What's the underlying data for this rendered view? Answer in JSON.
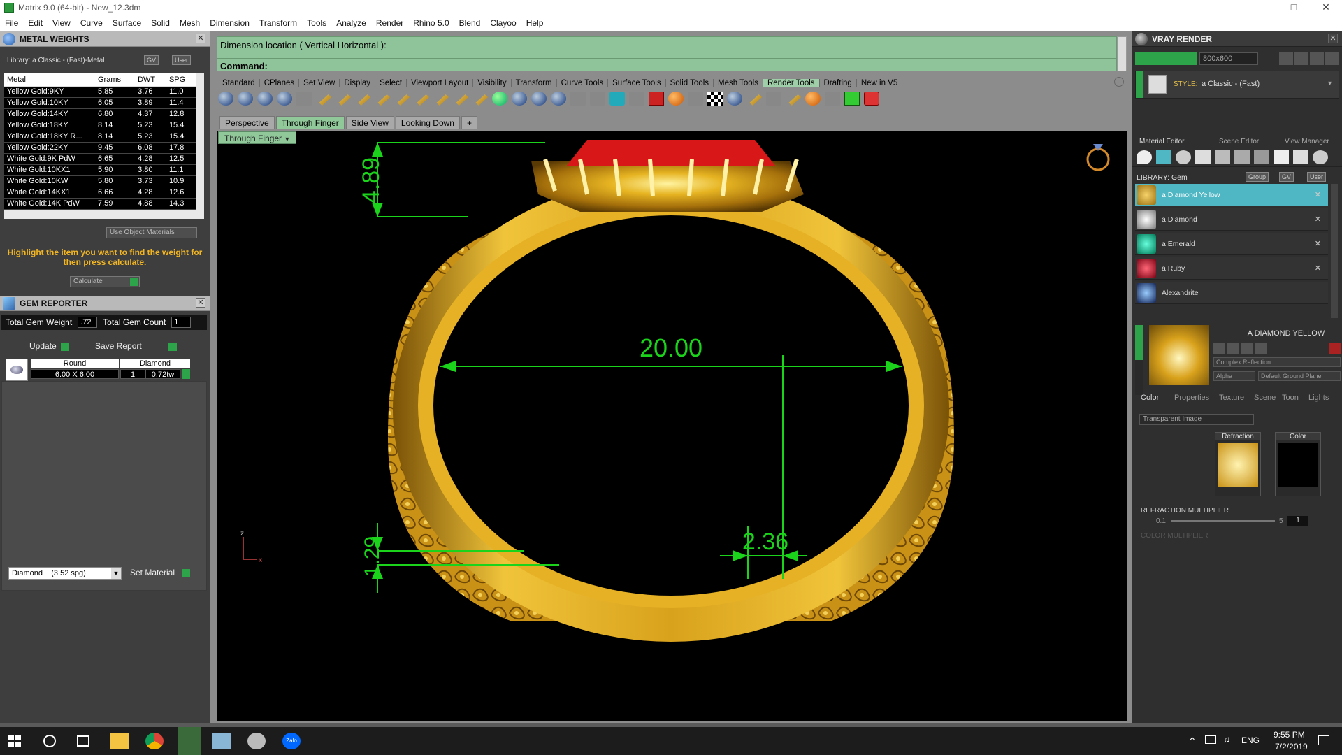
{
  "window": {
    "title": "Matrix 9.0 (64-bit) - New_12.3dm"
  },
  "menu": [
    "File",
    "Edit",
    "View",
    "Curve",
    "Surface",
    "Solid",
    "Mesh",
    "Dimension",
    "Transform",
    "Tools",
    "Analyze",
    "Render",
    "Rhino 5.0",
    "Blend",
    "Clayoo",
    "Help"
  ],
  "metal_weights": {
    "title": "METAL WEIGHTS",
    "library": "Library: a Classic - (Fast)-Metal",
    "gv_label": "GV",
    "user_label": "User",
    "columns": [
      "Metal",
      "Grams",
      "DWT",
      "SPG"
    ],
    "rows": [
      [
        "Yellow Gold:9KY",
        "5.85",
        "3.76",
        "11.0"
      ],
      [
        "Yellow Gold:10KY",
        "6.05",
        "3.89",
        "11.4"
      ],
      [
        "Yellow Gold:14KY",
        "6.80",
        "4.37",
        "12.8"
      ],
      [
        "Yellow Gold:18KY",
        "8.14",
        "5.23",
        "15.4"
      ],
      [
        "Yellow Gold:18KY R...",
        "8.14",
        "5.23",
        "15.4"
      ],
      [
        "Yellow Gold:22KY",
        "9.45",
        "6.08",
        "17.8"
      ],
      [
        "White Gold:9K PdW",
        "6.65",
        "4.28",
        "12.5"
      ],
      [
        "White Gold:10KX1",
        "5.90",
        "3.80",
        "11.1"
      ],
      [
        "White Gold:10KW",
        "5.80",
        "3.73",
        "10.9"
      ],
      [
        "White Gold:14KX1",
        "6.66",
        "4.28",
        "12.6"
      ],
      [
        "White Gold:14K PdW",
        "7.59",
        "4.88",
        "14.3"
      ]
    ],
    "use_object_materials": "Use Object Materials",
    "hint": "Highlight the item you want to find the weight for then press calculate.",
    "calculate": "Calculate"
  },
  "gem_reporter": {
    "title": "GEM REPORTER",
    "total_weight_label": "Total Gem Weight",
    "total_weight": ".72",
    "total_count_label": "Total Gem Count",
    "total_count": "1",
    "update": "Update",
    "save_report": "Save Report",
    "gem": {
      "shape": "Round",
      "type": "Diamond",
      "size": "6.00 X 6.00",
      "count": "1",
      "weight": "0.72tw"
    },
    "material_select": "Diamond    (3.52 spg)",
    "set_material": "Set Material"
  },
  "command": {
    "line1": "Dimension location ( Vertical  Horizontal ):",
    "line2": "Command:"
  },
  "toolbar_tabs": [
    "Standard",
    "CPlanes",
    "Set View",
    "Display",
    "Select",
    "Viewport Layout",
    "Visibility",
    "Transform",
    "Curve Tools",
    "Surface Tools",
    "Solid Tools",
    "Mesh Tools",
    "Render Tools",
    "Drafting",
    "New in V5"
  ],
  "active_toolbar_tab": "Render Tools",
  "view_tabs": [
    "Perspective",
    "Through Finger",
    "Side View",
    "Looking Down"
  ],
  "active_view": "Through Finger",
  "viewport": {
    "label": "Through Finger",
    "dims": {
      "height": "4.89",
      "diameter": "20.00",
      "bottom": "1.29",
      "width": "2.36"
    },
    "axis_z": "z",
    "axis_x": "x"
  },
  "vray": {
    "title": "VRAY RENDER",
    "resolution": "800x600",
    "style_label": "STYLE:",
    "style": "a Classic - (Fast)",
    "tabs": [
      "Material Editor",
      "Scene Editor",
      "View Manager"
    ],
    "library_label": "LIBRARY: Gem",
    "group": "Group",
    "gv": "GV",
    "user": "User",
    "materials": [
      "a Diamond Yellow",
      "a Diamond",
      "a Emerald",
      "a Ruby",
      "Alexandrite"
    ],
    "selected_material_title": "A DIAMOND YELLOW",
    "reflection": "Complex Reflection",
    "alpha": "Alpha",
    "ground": "Default Ground Plane",
    "sub_tabs": [
      "Color",
      "Properties",
      "Texture",
      "Scene",
      "Toon",
      "Lights"
    ],
    "transparent": "Transparent Image",
    "refraction_label": "Refraction",
    "color_label": "Color",
    "refraction_multiplier": "REFRACTION MULTIPLIER",
    "color_multiplier": "COLOR MULTIPLIER",
    "min": "0.1",
    "max": "5",
    "value": "1"
  },
  "taskbar": {
    "time": "9:55 PM",
    "date": "7/2/2019",
    "lang": "ENG",
    "zalo": "Zalo"
  }
}
